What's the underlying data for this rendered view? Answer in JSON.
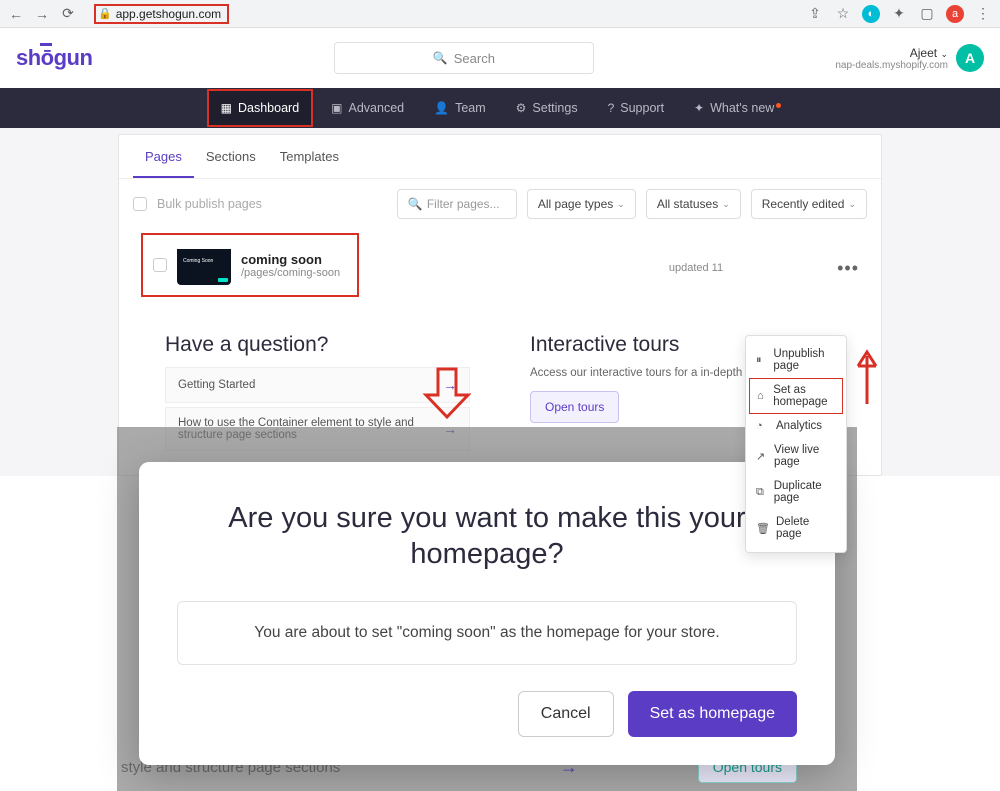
{
  "browser": {
    "url": "app.getshogun.com",
    "ext_letter": "a"
  },
  "header": {
    "logo": "shōgun",
    "search_placeholder": "Search",
    "user_name": "Ajeet",
    "user_sub": "nap-deals.myshopify.com",
    "avatar_letter": "A"
  },
  "nav": {
    "items": [
      {
        "label": "Dashboard",
        "icon": "grid"
      },
      {
        "label": "Advanced",
        "icon": "window"
      },
      {
        "label": "Team",
        "icon": "person"
      },
      {
        "label": "Settings",
        "icon": "gear"
      },
      {
        "label": "Support",
        "icon": "help"
      },
      {
        "label": "What's new",
        "icon": "spark"
      }
    ]
  },
  "tabs": {
    "pages": "Pages",
    "sections": "Sections",
    "templates": "Templates"
  },
  "toolbar": {
    "bulk": "Bulk publish pages",
    "filter_placeholder": "Filter pages...",
    "page_types": "All page types",
    "statuses": "All statuses",
    "sort": "Recently edited"
  },
  "page_row": {
    "title": "coming soon",
    "path": "/pages/coming-soon",
    "updated": "updated 11"
  },
  "ctx": {
    "unpublish": "Unpublish page",
    "set_home": "Set as homepage",
    "analytics": "Analytics",
    "view_live": "View live page",
    "duplicate": "Duplicate page",
    "delete": "Delete page"
  },
  "help": {
    "question_title": "Have a question?",
    "q1": "Getting Started",
    "q2": "How to use the Container element to style and structure page sections",
    "tours_title": "Interactive tours",
    "tours_text": "Access our interactive tours for a in-depth overview",
    "tours_btn": "Open tours"
  },
  "modal": {
    "title": "Are you sure you want to make this your homepage?",
    "body": "You are about to set \"coming soon\" as the homepage for your store.",
    "cancel": "Cancel",
    "confirm": "Set as homepage"
  },
  "ghost": {
    "text": "style and structure page sections",
    "btn": "Open tours"
  }
}
